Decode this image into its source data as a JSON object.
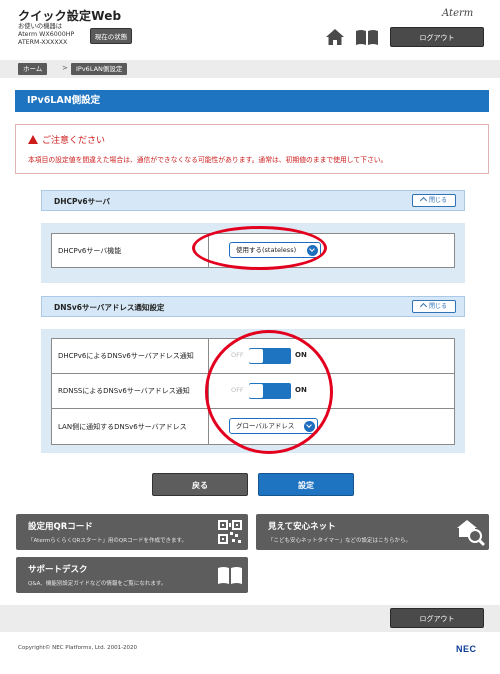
{
  "header": {
    "site_title": "クイック設定Web",
    "device_label": "お使いの機器は",
    "device_model": "Aterm WX6000HP",
    "device_id": "ATERM-XXXXXX",
    "status_button": "現在の状態",
    "brand": "Aterm",
    "logout": "ログアウト"
  },
  "breadcrumb": {
    "home": "ホーム",
    "separator": ">",
    "current": "IPv6LAN側設定"
  },
  "page": {
    "title": "IPv6LAN側設定"
  },
  "notice": {
    "title": "ご注意ください",
    "text": "本項目の設定値を間違えた場合は、通信ができなくなる可能性があります。通常は、初期値のままで使用して下さい。"
  },
  "dhcp_section": {
    "title": "DHCPv6サーバ",
    "close_label": "閉じる",
    "rows": [
      {
        "label": "DHCPv6サーバ機能",
        "value": "使用する(stateless)"
      }
    ]
  },
  "dns_section": {
    "title": "DNSv6サーバアドレス通知設定",
    "close_label": "閉じる",
    "rows": [
      {
        "label": "DHCPv6によるDNSv6サーバアドレス通知",
        "off": "OFF",
        "on": "ON",
        "state": "on"
      },
      {
        "label": "RDNSSによるDNSv6サーバアドレス通知",
        "off": "OFF",
        "on": "ON",
        "state": "on"
      },
      {
        "label": "LAN側に通知するDNSv6サーバアドレス",
        "value": "グローバルアドレス"
      }
    ]
  },
  "actions": {
    "back": "戻る",
    "submit": "設定"
  },
  "tiles": {
    "qr": {
      "title": "設定用QRコード",
      "desc": "「AtermらくらくQRスタート」用のQRコードを作成できます。"
    },
    "safe": {
      "title": "見えて安心ネット",
      "desc": "「こども安心ネットタイマー」などの設定はこちらから。"
    },
    "support": {
      "title": "サポートデスク",
      "desc": "Q&A、機能別設定ガイドなどの情報をご覧になれます。"
    }
  },
  "footer": {
    "logout": "ログアウト",
    "copyright": "Copyright© NEC Platforms, Ltd. 2001-2020",
    "logo": "NEC"
  },
  "colors": {
    "accent": "#1e74c1",
    "dark_button": "#5d5d5d",
    "warning": "#cc1c1c",
    "highlight": "#e3001e"
  }
}
